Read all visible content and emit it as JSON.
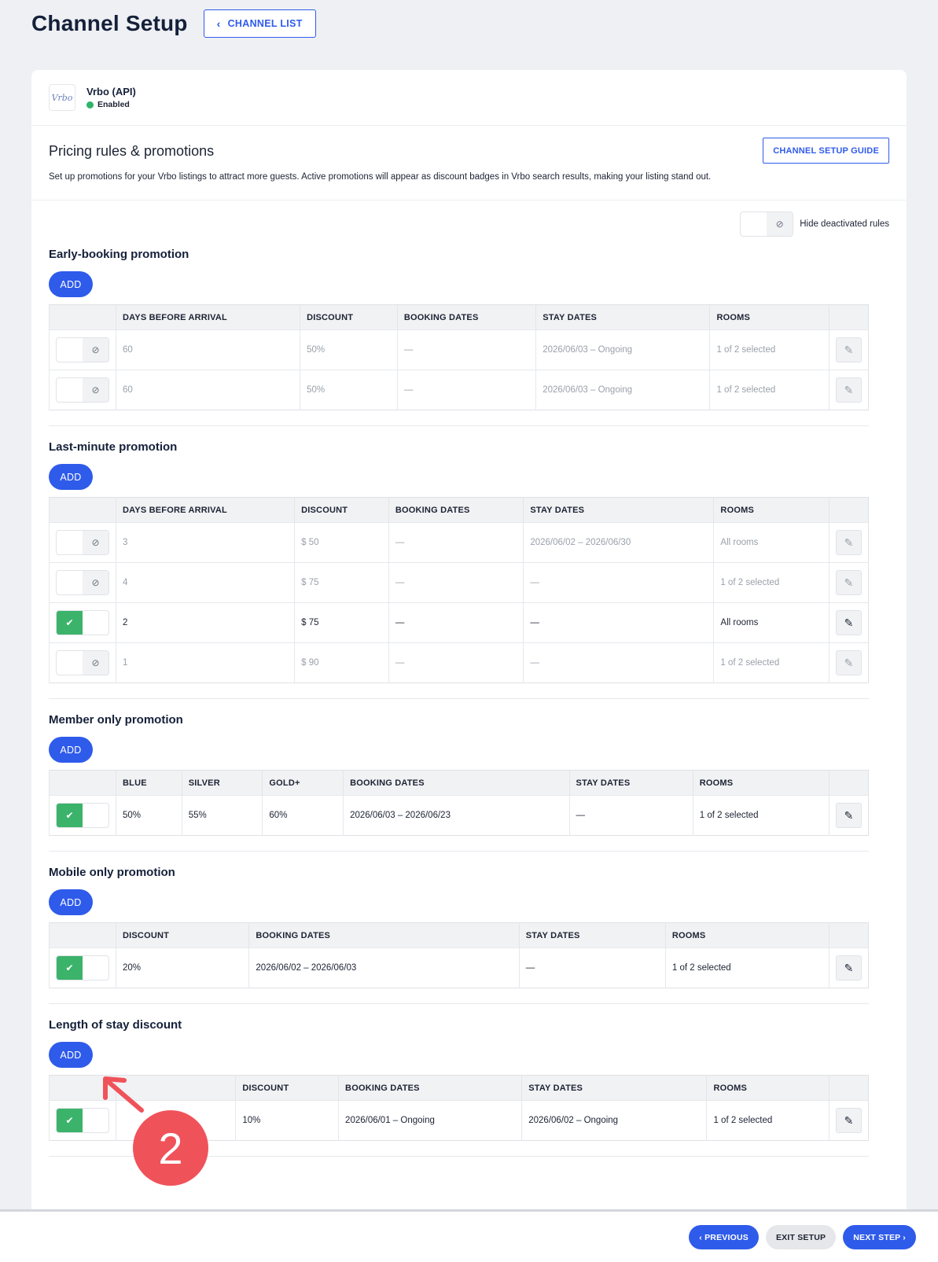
{
  "header": {
    "title": "Channel Setup",
    "channel_list_label": "CHANNEL LIST"
  },
  "channel": {
    "logo_text": "Vrbo",
    "name": "Vrbo (API)",
    "status": "Enabled",
    "status_color": "#2fb36a"
  },
  "intro": {
    "title": "Pricing rules & promotions",
    "description": "Set up promotions for your Vrbo listings to attract more guests. Active promotions will appear as discount badges in Vrbo search results, making your listing stand out.",
    "guide_label": "CHANNEL SETUP GUIDE"
  },
  "filter": {
    "label": "Hide deactivated rules",
    "icon": "ban-icon"
  },
  "add_label": "ADD",
  "sections": {
    "early": {
      "title": "Early-booking promotion",
      "columns": [
        "DAYS BEFORE ARRIVAL",
        "DISCOUNT",
        "BOOKING DATES",
        "STAY DATES",
        "ROOMS"
      ],
      "rows": [
        {
          "active": false,
          "cells": [
            "60",
            "50%",
            "—",
            "2026/06/03 – Ongoing",
            "1 of 2 selected"
          ]
        },
        {
          "active": false,
          "cells": [
            "60",
            "50%",
            "—",
            "2026/06/03 – Ongoing",
            "1 of 2 selected"
          ]
        }
      ]
    },
    "last": {
      "title": "Last-minute promotion",
      "columns": [
        "DAYS BEFORE ARRIVAL",
        "DISCOUNT",
        "BOOKING DATES",
        "STAY DATES",
        "ROOMS"
      ],
      "rows": [
        {
          "active": false,
          "cells": [
            "3",
            "$ 50",
            "—",
            "2026/06/02 – 2026/06/30",
            "All rooms"
          ]
        },
        {
          "active": false,
          "cells": [
            "4",
            "$ 75",
            "—",
            "—",
            "1 of 2 selected"
          ]
        },
        {
          "active": true,
          "cells": [
            "2",
            "$ 75",
            "—",
            "—",
            "All rooms"
          ]
        },
        {
          "active": false,
          "cells": [
            "1",
            "$ 90",
            "—",
            "—",
            "1 of 2 selected"
          ]
        }
      ]
    },
    "member": {
      "title": "Member only promotion",
      "columns": [
        "BLUE",
        "SILVER",
        "GOLD+",
        "BOOKING DATES",
        "STAY DATES",
        "ROOMS"
      ],
      "rows": [
        {
          "active": true,
          "cells": [
            "50%",
            "55%",
            "60%",
            "2026/06/03 – 2026/06/23",
            "—",
            "1 of 2 selected"
          ]
        }
      ]
    },
    "mobile": {
      "title": "Mobile only promotion",
      "columns": [
        "DISCOUNT",
        "BOOKING DATES",
        "STAY DATES",
        "ROOMS"
      ],
      "rows": [
        {
          "active": true,
          "cells": [
            "20%",
            "2026/06/02 – 2026/06/03",
            "—",
            "1 of 2 selected"
          ]
        }
      ]
    },
    "length": {
      "title": "Length of stay discount",
      "columns": [
        "",
        "DISCOUNT",
        "BOOKING DATES",
        "STAY DATES",
        "ROOMS"
      ],
      "rows": [
        {
          "active": true,
          "cells": [
            "",
            "10%",
            "2026/06/01 – Ongoing",
            "2026/06/02 – Ongoing",
            "1 of 2 selected"
          ]
        }
      ]
    }
  },
  "footer": {
    "previous_label": "‹ PREVIOUS",
    "exit_label": "EXIT SETUP",
    "next_label": "NEXT STEP ›"
  },
  "annotation": {
    "number": "2",
    "color": "#f0525a"
  },
  "colors": {
    "accent": "#2f5bea",
    "active_toggle": "#3bb36a"
  }
}
